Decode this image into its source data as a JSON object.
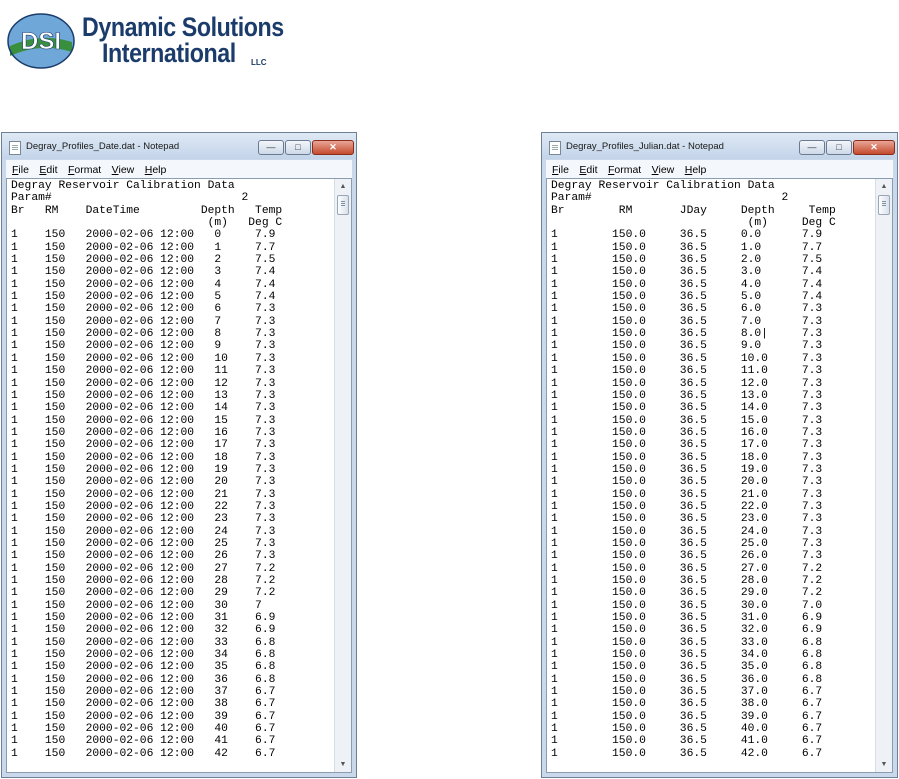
{
  "logo": {
    "seal_text": "DSI",
    "line1": "Dynamic Solutions",
    "line2": "International",
    "suffix": "LLC",
    "colors": {
      "dark_blue": "#1b3c6b",
      "green": "#3a8f3f",
      "light_blue": "#6fa8d8"
    }
  },
  "windows": [
    {
      "title": "Degray_Profiles_Date.dat - Notepad",
      "minimize_label": "—",
      "maximize_label": "□",
      "close_label": "✕",
      "menu": [
        "File",
        "Edit",
        "Format",
        "View",
        "Help"
      ],
      "lines": [
        "Degray Reservoir Calibration Data",
        "Param#                            2",
        "Br   RM    DateTime         Depth   Temp",
        "                             (m)   Deg C",
        "1    150   2000-02-06 12:00   0     7.9",
        "1    150   2000-02-06 12:00   1     7.7",
        "1    150   2000-02-06 12:00   2     7.5",
        "1    150   2000-02-06 12:00   3     7.4",
        "1    150   2000-02-06 12:00   4     7.4",
        "1    150   2000-02-06 12:00   5     7.4",
        "1    150   2000-02-06 12:00   6     7.3",
        "1    150   2000-02-06 12:00   7     7.3",
        "1    150   2000-02-06 12:00   8     7.3",
        "1    150   2000-02-06 12:00   9     7.3",
        "1    150   2000-02-06 12:00   10    7.3",
        "1    150   2000-02-06 12:00   11    7.3",
        "1    150   2000-02-06 12:00   12    7.3",
        "1    150   2000-02-06 12:00   13    7.3",
        "1    150   2000-02-06 12:00   14    7.3",
        "1    150   2000-02-06 12:00   15    7.3",
        "1    150   2000-02-06 12:00   16    7.3",
        "1    150   2000-02-06 12:00   17    7.3",
        "1    150   2000-02-06 12:00   18    7.3",
        "1    150   2000-02-06 12:00   19    7.3",
        "1    150   2000-02-06 12:00   20    7.3",
        "1    150   2000-02-06 12:00   21    7.3",
        "1    150   2000-02-06 12:00   22    7.3",
        "1    150   2000-02-06 12:00   23    7.3",
        "1    150   2000-02-06 12:00   24    7.3",
        "1    150   2000-02-06 12:00   25    7.3",
        "1    150   2000-02-06 12:00   26    7.3",
        "1    150   2000-02-06 12:00   27    7.2",
        "1    150   2000-02-06 12:00   28    7.2",
        "1    150   2000-02-06 12:00   29    7.2",
        "1    150   2000-02-06 12:00   30    7",
        "1    150   2000-02-06 12:00   31    6.9",
        "1    150   2000-02-06 12:00   32    6.9",
        "1    150   2000-02-06 12:00   33    6.8",
        "1    150   2000-02-06 12:00   34    6.8",
        "1    150   2000-02-06 12:00   35    6.8",
        "1    150   2000-02-06 12:00   36    6.8",
        "1    150   2000-02-06 12:00   37    6.7",
        "1    150   2000-02-06 12:00   38    6.7",
        "1    150   2000-02-06 12:00   39    6.7",
        "1    150   2000-02-06 12:00   40    6.7",
        "1    150   2000-02-06 12:00   41    6.7",
        "1    150   2000-02-06 12:00   42    6.7"
      ]
    },
    {
      "title": "Degray_Profiles_Julian.dat - Notepad",
      "minimize_label": "—",
      "maximize_label": "□",
      "close_label": "✕",
      "menu": [
        "File",
        "Edit",
        "Format",
        "View",
        "Help"
      ],
      "lines": [
        "Degray Reservoir Calibration Data",
        "Param#                            2",
        "Br        RM       JDay     Depth     Temp",
        "                             (m)     Deg C",
        "1        150.0     36.5     0.0      7.9",
        "1        150.0     36.5     1.0      7.7",
        "1        150.0     36.5     2.0      7.5",
        "1        150.0     36.5     3.0      7.4",
        "1        150.0     36.5     4.0      7.4",
        "1        150.0     36.5     5.0      7.4",
        "1        150.0     36.5     6.0      7.3",
        "1        150.0     36.5     7.0      7.3",
        "1        150.0     36.5     8.0|     7.3",
        "1        150.0     36.5     9.0      7.3",
        "1        150.0     36.5     10.0     7.3",
        "1        150.0     36.5     11.0     7.3",
        "1        150.0     36.5     12.0     7.3",
        "1        150.0     36.5     13.0     7.3",
        "1        150.0     36.5     14.0     7.3",
        "1        150.0     36.5     15.0     7.3",
        "1        150.0     36.5     16.0     7.3",
        "1        150.0     36.5     17.0     7.3",
        "1        150.0     36.5     18.0     7.3",
        "1        150.0     36.5     19.0     7.3",
        "1        150.0     36.5     20.0     7.3",
        "1        150.0     36.5     21.0     7.3",
        "1        150.0     36.5     22.0     7.3",
        "1        150.0     36.5     23.0     7.3",
        "1        150.0     36.5     24.0     7.3",
        "1        150.0     36.5     25.0     7.3",
        "1        150.0     36.5     26.0     7.3",
        "1        150.0     36.5     27.0     7.2",
        "1        150.0     36.5     28.0     7.2",
        "1        150.0     36.5     29.0     7.2",
        "1        150.0     36.5     30.0     7.0",
        "1        150.0     36.5     31.0     6.9",
        "1        150.0     36.5     32.0     6.9",
        "1        150.0     36.5     33.0     6.8",
        "1        150.0     36.5     34.0     6.8",
        "1        150.0     36.5     35.0     6.8",
        "1        150.0     36.5     36.0     6.8",
        "1        150.0     36.5     37.0     6.7",
        "1        150.0     36.5     38.0     6.7",
        "1        150.0     36.5     39.0     6.7",
        "1        150.0     36.5     40.0     6.7",
        "1        150.0     36.5     41.0     6.7",
        "1        150.0     36.5     42.0     6.7"
      ]
    }
  ]
}
